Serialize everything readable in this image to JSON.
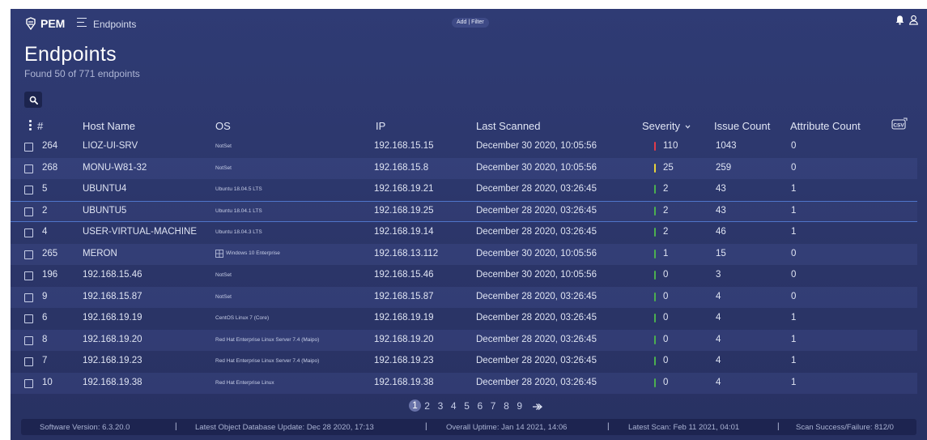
{
  "app": {
    "logo_text": "PEM",
    "breadcrumb": "Endpoints",
    "filter_button": "Add | Filter"
  },
  "page": {
    "title": "Endpoints",
    "subtitle": "Found 50 of 771 endpoints"
  },
  "table": {
    "columns": {
      "id": "#",
      "host": "Host Name",
      "os": "OS",
      "ip": "IP",
      "scanned": "Last Scanned",
      "severity": "Severity",
      "issues": "Issue Count",
      "attributes": "Attribute Count"
    },
    "severity_sort_icon": "chevron-down-icon",
    "rows": [
      {
        "id": "264",
        "host": "LIOZ-UI-SRV",
        "os": "NotSet",
        "ip": "192.168.15.15",
        "scanned": "December 30 2020, 10:05:56",
        "severity": "110",
        "sev_color": "#e23b4b",
        "issues": "1043",
        "attributes": "0"
      },
      {
        "id": "268",
        "host": "MONU-W81-32",
        "os": "NotSet",
        "ip": "192.168.15.8",
        "scanned": "December 30 2020, 10:05:56",
        "severity": "25",
        "sev_color": "#e8d53c",
        "issues": "259",
        "attributes": "0"
      },
      {
        "id": "5",
        "host": "UBUNTU4",
        "os": "Ubuntu 18.04.5 LTS",
        "ip": "192.168.19.21",
        "scanned": "December 28 2020, 03:26:45",
        "severity": "2",
        "sev_color": "#4caf50",
        "issues": "43",
        "attributes": "1"
      },
      {
        "id": "2",
        "host": "UBUNTU5",
        "os": "Ubuntu 18.04.1 LTS",
        "ip": "192.168.19.25",
        "scanned": "December 28 2020, 03:26:45",
        "severity": "2",
        "sev_color": "#4caf50",
        "issues": "43",
        "attributes": "1"
      },
      {
        "id": "4",
        "host": "USER-VIRTUAL-MACHINE",
        "os": "Ubuntu 18.04.3 LTS",
        "ip": "192.168.19.14",
        "scanned": "December 28 2020, 03:26:45",
        "severity": "2",
        "sev_color": "#4caf50",
        "issues": "46",
        "attributes": "1"
      },
      {
        "id": "265",
        "host": "MERON",
        "os": "Windows 10 Enterprise",
        "ip": "192.168.13.112",
        "scanned": "December 30 2020, 10:05:56",
        "severity": "1",
        "sev_color": "#4caf50",
        "issues": "15",
        "attributes": "0"
      },
      {
        "id": "196",
        "host": "192.168.15.46",
        "os": "NotSet",
        "ip": "192.168.15.46",
        "scanned": "December 30 2020, 10:05:56",
        "severity": "0",
        "sev_color": "#4caf50",
        "issues": "3",
        "attributes": "0"
      },
      {
        "id": "9",
        "host": "192.168.15.87",
        "os": "NotSet",
        "ip": "192.168.15.87",
        "scanned": "December 28 2020, 03:26:45",
        "severity": "0",
        "sev_color": "#4caf50",
        "issues": "4",
        "attributes": "0"
      },
      {
        "id": "6",
        "host": "192.168.19.19",
        "os": "CentOS Linux 7 (Core)",
        "ip": "192.168.19.19",
        "scanned": "December 28 2020, 03:26:45",
        "severity": "0",
        "sev_color": "#4caf50",
        "issues": "4",
        "attributes": "1"
      },
      {
        "id": "8",
        "host": "192.168.19.20",
        "os": "Red Hat Enterprise Linux Server 7.4 (Maipo)",
        "ip": "192.168.19.20",
        "scanned": "December 28 2020, 03:26:45",
        "severity": "0",
        "sev_color": "#4caf50",
        "issues": "4",
        "attributes": "1"
      },
      {
        "id": "7",
        "host": "192.168.19.23",
        "os": "Red Hat Enterprise Linux Server 7.4 (Maipo)",
        "ip": "192.168.19.23",
        "scanned": "December 28 2020, 03:26:45",
        "severity": "0",
        "sev_color": "#4caf50",
        "issues": "4",
        "attributes": "1"
      },
      {
        "id": "10",
        "host": "192.168.19.38",
        "os": "Red Hat Enterprise Linux",
        "ip": "192.168.19.38",
        "scanned": "December 28 2020, 03:26:45",
        "severity": "0",
        "sev_color": "#4caf50",
        "issues": "4",
        "attributes": "1"
      }
    ],
    "selected_row": "2"
  },
  "pagination": {
    "pages": [
      "1",
      "2",
      "3",
      "4",
      "5",
      "6",
      "7",
      "8",
      "9"
    ],
    "current": "1"
  },
  "footer": {
    "software_version": "Software Version: 6.3.20.0",
    "db_update": "Latest Object Database Update: Dec 28 2020, 17:13",
    "uptime": "Overall Uptime: Jan 14 2021, 14:06",
    "latest_scan": "Latest Scan: Feb 11 2021, 04:01",
    "scan_ratio": "Scan Success/Failure: 812/0"
  },
  "colors": {
    "background": "#2d3870",
    "footer": "#1d2450",
    "selection": "#4f74c9"
  }
}
